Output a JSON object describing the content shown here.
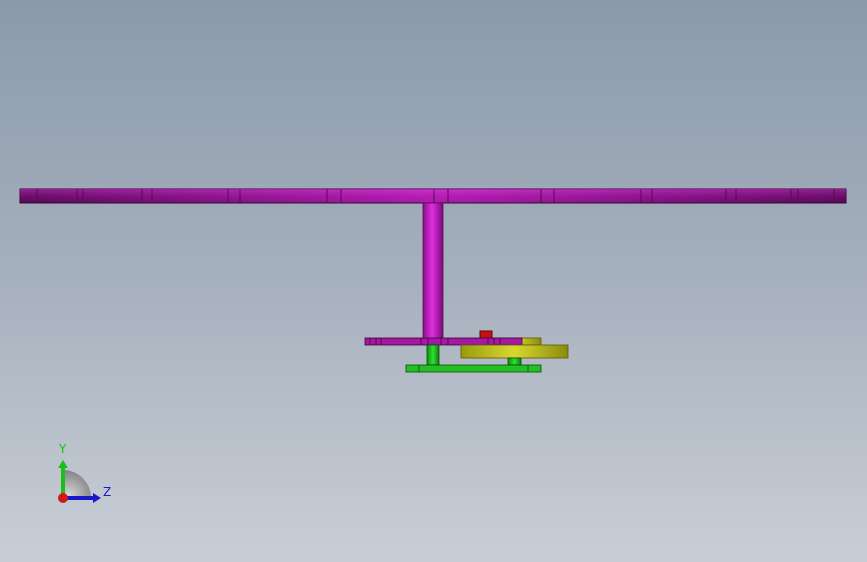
{
  "viewport": {
    "background_top": "#8b9aab",
    "background_bottom": "#c9ced6"
  },
  "model": {
    "parts": [
      {
        "name": "top-bar",
        "color": "#c010c0"
      },
      {
        "name": "vertical-shaft",
        "color": "#c010c0"
      },
      {
        "name": "lower-plate",
        "color": "#a010a0"
      },
      {
        "name": "yellow-gear",
        "color": "#b8b81a"
      },
      {
        "name": "green-base",
        "color": "#18b818"
      },
      {
        "name": "red-marker",
        "color": "#c81010"
      }
    ]
  },
  "triad": {
    "y_label": "Y",
    "z_label": "Z",
    "y_color": "#18c018",
    "z_color": "#1818c8",
    "x_color": "#d01818"
  }
}
